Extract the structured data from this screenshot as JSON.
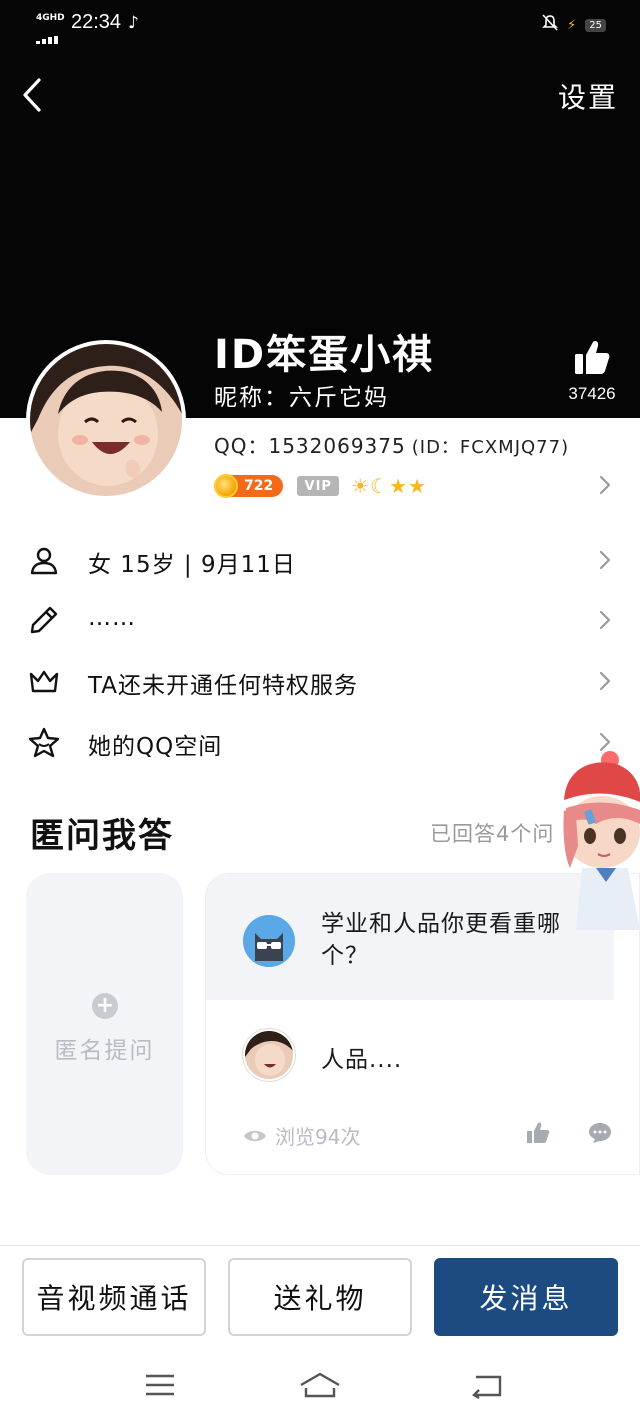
{
  "status_bar": {
    "network": "4GHD",
    "time": "22:34",
    "battery": "25"
  },
  "header": {
    "settings_label": "设置"
  },
  "profile": {
    "display_name": "ID笨蛋小祺",
    "nickname_label": "昵称：",
    "nickname": "六斤它妈",
    "likes": "37426",
    "qq_label": "QQ：",
    "qq_number": "1532069375",
    "qq_id": "(ID：FCXMJQ77)",
    "coin_count": "722",
    "vip_label": "VIP",
    "level_icons": "☀☾★★"
  },
  "info_rows": [
    {
      "icon": "person-icon",
      "label": "女  15岁 | 9月11日"
    },
    {
      "icon": "pencil-icon",
      "label": "……"
    },
    {
      "icon": "crown-icon",
      "label": "TA还未开通任何特权服务"
    },
    {
      "icon": "star-icon",
      "label": "她的QQ空间"
    }
  ],
  "qa_section": {
    "title": "匿问我答",
    "answered_count": "已回答4个问",
    "ask_label": "匿名提问",
    "question": "学业和人品你更看重哪个？",
    "answer": "人品....",
    "views": "浏览94次"
  },
  "actions": {
    "call_label": "音视频通话",
    "gift_label": "送礼物",
    "message_label": "发消息"
  },
  "colors": {
    "primary": "#1c4b82",
    "cover": "#050505",
    "coin_badge": "#f46a1b",
    "vip_badge": "#b5b5b5"
  }
}
